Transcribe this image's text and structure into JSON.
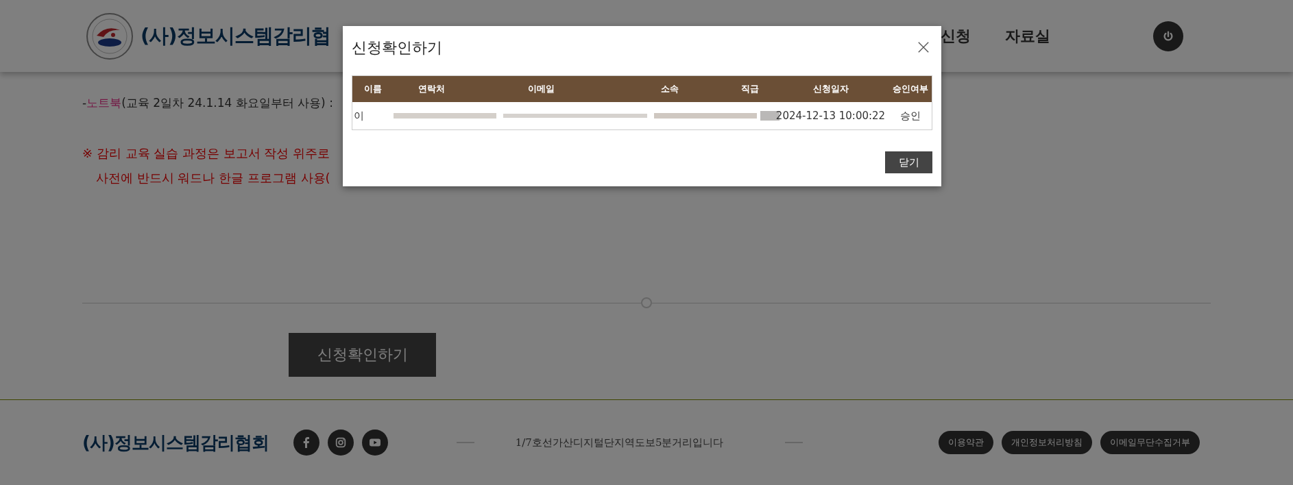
{
  "header": {
    "logo_text": "(사)정보시스템감리협",
    "nav": [
      {
        "label": "신청"
      },
      {
        "label": "자료실"
      }
    ]
  },
  "content": {
    "note": {
      "dash": "-",
      "item": "노트북",
      "text": "(교육 2일차 24.1.14 화요일부터 사용) :"
    },
    "warning_lines": [
      "※ 감리 교육 실습 과정은 보고서 작성 위주로",
      "사전에 반드시 워드나 한글 프로그램 사용("
    ],
    "apply_button": "신청확인하기"
  },
  "footer": {
    "logo_text": "(사)정보시스템감리협회",
    "address": "1/7호선가산디지털단지역도보5분거리입니다",
    "links": [
      "이용약관",
      "개인정보처리방침",
      "이메일무단수집거부"
    ]
  },
  "modal": {
    "title": "신청확인하기",
    "columns": [
      "이름",
      "연락처",
      "이메일",
      "소속",
      "직급",
      "신청일자",
      "승인여부"
    ],
    "rows": [
      {
        "name": "이",
        "redacted": true,
        "date": "2024-12-13 10:00:22",
        "status": "승인"
      }
    ],
    "close_label": "닫기"
  }
}
